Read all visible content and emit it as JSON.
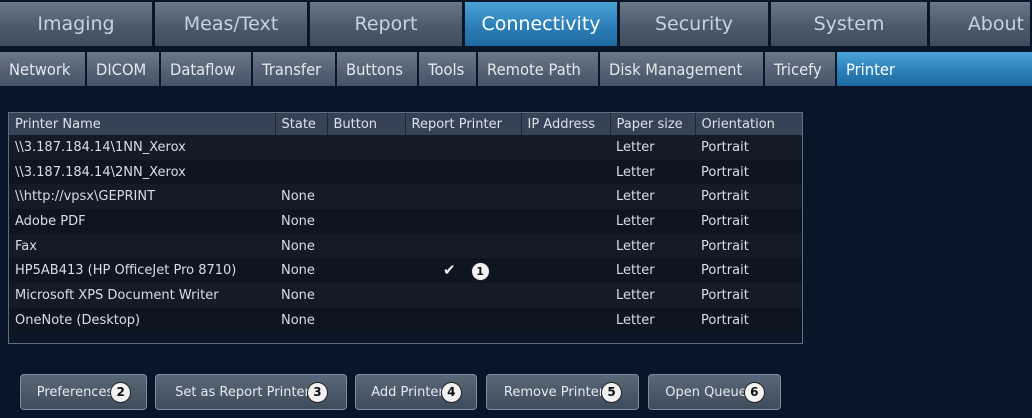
{
  "main_tabs": [
    "Imaging",
    "Meas/Text",
    "Report",
    "Connectivity",
    "Security",
    "System",
    "About"
  ],
  "active_main_tab": "Connectivity",
  "sub_tabs": [
    "Network",
    "DICOM",
    "Dataflow",
    "Transfer",
    "Buttons",
    "Tools",
    "Remote Path",
    "Disk Management",
    "Tricefy",
    "Printer"
  ],
  "active_sub_tab": "Printer",
  "table": {
    "columns": [
      "Printer Name",
      "State",
      "Button",
      "Report Printer",
      "IP Address",
      "Paper size",
      "Orientation"
    ],
    "rows": [
      {
        "name": "\\\\3.187.184.14\\1NN_Xerox",
        "state": "",
        "button": "",
        "report": "",
        "ip": "",
        "paper": "Letter",
        "orientation": "Portrait"
      },
      {
        "name": "\\\\3.187.184.14\\2NN_Xerox",
        "state": "",
        "button": "",
        "report": "",
        "ip": "",
        "paper": "Letter",
        "orientation": "Portrait"
      },
      {
        "name": "\\\\http://vpsx\\GEPRINT",
        "state": "None",
        "button": "",
        "report": "",
        "ip": "",
        "paper": "Letter",
        "orientation": "Portrait"
      },
      {
        "name": "Adobe PDF",
        "state": "None",
        "button": "",
        "report": "",
        "ip": "",
        "paper": "Letter",
        "orientation": "Portrait"
      },
      {
        "name": "Fax",
        "state": "None",
        "button": "",
        "report": "",
        "ip": "",
        "paper": "Letter",
        "orientation": "Portrait"
      },
      {
        "name": "HP5AB413 (HP OfficeJet Pro 8710)",
        "state": "None",
        "button": "",
        "report": "✔",
        "ip": "",
        "paper": "Letter",
        "orientation": "Portrait"
      },
      {
        "name": "Microsoft XPS Document Writer",
        "state": "None",
        "button": "",
        "report": "",
        "ip": "",
        "paper": "Letter",
        "orientation": "Portrait"
      },
      {
        "name": "OneNote (Desktop)",
        "state": "None",
        "button": "",
        "report": "",
        "ip": "",
        "paper": "Letter",
        "orientation": "Portrait"
      }
    ],
    "row_callout": "1"
  },
  "buttons": [
    {
      "label": "Preferences",
      "callout": "2"
    },
    {
      "label": "Set as Report Printer",
      "callout": "3"
    },
    {
      "label": "Add Printer",
      "callout": "4"
    },
    {
      "label": "Remove Printer",
      "callout": "5"
    },
    {
      "label": "Open Queue",
      "callout": "6"
    }
  ],
  "colors": {
    "background": "#091629",
    "active_tab": "#2c7fb8",
    "inactive_tab": "#4c5b6c"
  }
}
